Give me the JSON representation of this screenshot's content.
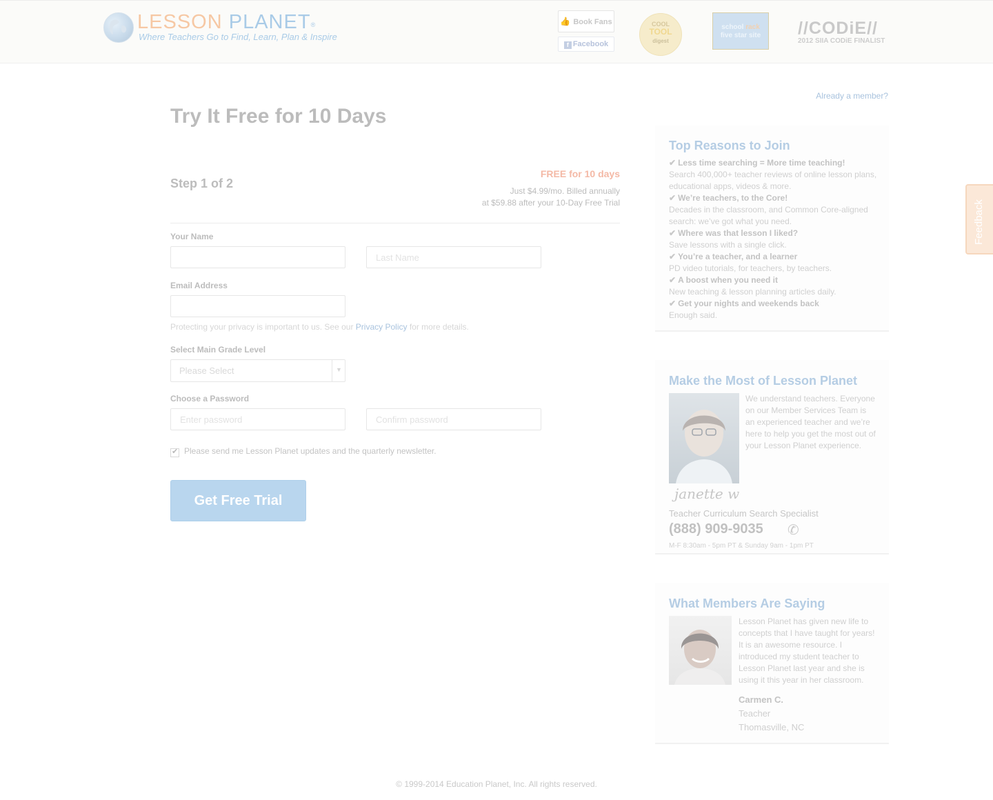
{
  "header": {
    "brand_word1": "LESSON",
    "brand_word2": "PLANET",
    "brand_mark": "®",
    "tagline": "Where Teachers Go to Find, Learn, Plan & Inspire",
    "fb_fans_label": "Book Fans",
    "fb_link_label": "Facebook",
    "badge_cool": {
      "line1": "COOL",
      "line2": "TOOL",
      "line3": "digest"
    },
    "badge_school": {
      "line1": "school",
      "line1_accent": "rack",
      "line2": "five star site"
    },
    "codie_logo": "//CODiE//",
    "codie_caption": "2012 SIIA CODiE FINALIST"
  },
  "auth": {
    "already_member": "Already a member?"
  },
  "form": {
    "title": "Try It Free for 10 Days",
    "step": "Step 1 of 2",
    "offer_headline": "FREE for 10 days",
    "offer_line1": "Just $4.99/mo. Billed annually",
    "offer_line2": "at $59.88 after your 10-Day Free Trial",
    "name_label": "Your Name",
    "first_name_value": "",
    "last_name_placeholder": "Last Name",
    "email_label": "Email Address",
    "email_value": "",
    "privacy_before": "Protecting your privacy is important to us. See our ",
    "privacy_link": "Privacy Policy",
    "privacy_after": " for more details.",
    "grade_label": "Select Main Grade Level",
    "grade_selected": "Please Select",
    "password_label": "Choose a Password",
    "password_placeholder": "Enter password",
    "confirm_placeholder": "Confirm password",
    "newsletter_checked": true,
    "newsletter_label": "Please send me Lesson Planet updates and the quarterly newsletter.",
    "submit_label": "Get Free Trial"
  },
  "sidebar": {
    "reasons_title": "Top Reasons to Join",
    "reasons": [
      {
        "head": "Less time searching = More time teaching!",
        "body": "Search 400,000+ teacher reviews of online lesson plans, educational apps, videos & more."
      },
      {
        "head": "We’re teachers, to the Core!",
        "body": "Decades in the classroom, and Common Core-aligned search: we’ve got what you need."
      },
      {
        "head": "Where was that lesson I liked?",
        "body": "Save lessons with a single click."
      },
      {
        "head": "You’re a teacher, and a learner",
        "body": "PD video tutorials, for teachers, by teachers."
      },
      {
        "head": "A boost when you need it",
        "body": "New teaching & lesson planning articles daily."
      },
      {
        "head": "Get your nights and weekends back",
        "body": "Enough said."
      }
    ],
    "most_title": "Make the Most of Lesson Planet",
    "most_body": "We understand teachers. Everyone on our Member Services Team is an experienced teacher and we’re here to help you get the most out of your Lesson Planet experience.",
    "signature": "janette w",
    "specialist_role": "Teacher Curriculum Search Specialist",
    "phone": "(888) 909-9035",
    "hours": "M-F 8:30am - 5pm PT & Sunday 9am - 1pm PT",
    "members_title": "What Members Are Saying",
    "quote": "Lesson Planet has given new life to concepts that I have taught for years! It is an awesome resource. I introduced my student teacher to Lesson Planet last year and she is using it this year in her classroom.",
    "quote_name": "Carmen C.",
    "quote_role": "Teacher",
    "quote_location": "Thomasville, NC"
  },
  "feedback_tab": "Feedback",
  "footer": {
    "copyright": "© 1999-2014 Education Planet, Inc. All rights reserved."
  },
  "icons": {
    "check": "check-icon",
    "phone": "phone-icon",
    "thumbs_up": "thumbs-up-icon",
    "globe": "globe-icon"
  },
  "colors": {
    "accent_blue": "#a9cbe7",
    "brand_orange": "#f6c8a4",
    "offer_red": "#f4b9a6",
    "cta_blue": "#b9d6ee"
  }
}
